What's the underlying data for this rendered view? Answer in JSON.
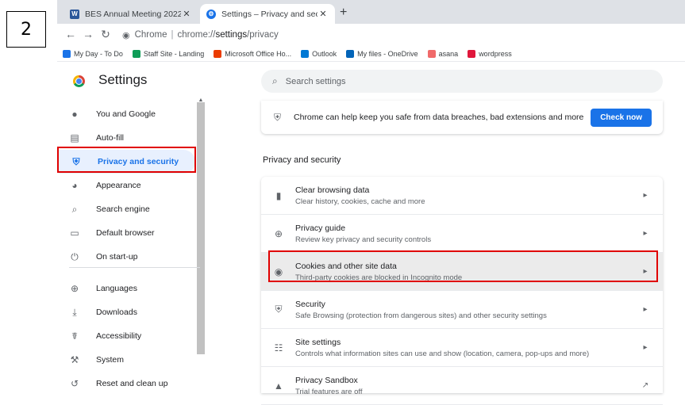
{
  "step_number": "2",
  "tabs": [
    {
      "label": "BES Annual Meeting 2022",
      "icon": "word-icon"
    },
    {
      "label": "Settings – Privacy and security",
      "icon": "settings-gear-icon"
    }
  ],
  "address": {
    "host": "Chrome",
    "path_prefix": "chrome://",
    "path_main": "settings",
    "path_suffix": "/privacy"
  },
  "bookmarks": [
    {
      "label": "My Day - To Do",
      "color": "#1a73e8"
    },
    {
      "label": "Staff Site - Landing",
      "color": "#0f9d58"
    },
    {
      "label": "Microsoft Office Ho...",
      "color": "#eb3c00"
    },
    {
      "label": "Outlook",
      "color": "#0078d4"
    },
    {
      "label": "My files - OneDrive",
      "color": "#0364b8"
    },
    {
      "label": "asana",
      "color": "#f06a6a"
    },
    {
      "label": "wordpress",
      "color": "#e0173b"
    }
  ],
  "settings_title": "Settings",
  "search_placeholder": "Search settings",
  "sidebar": [
    {
      "label": "You and Google",
      "icon": "person-icon",
      "glyph": "●"
    },
    {
      "label": "Auto-fill",
      "icon": "clipboard-icon",
      "glyph": "▤"
    },
    {
      "label": "Privacy and security",
      "icon": "shield-icon",
      "glyph": "⛨"
    },
    {
      "label": "Appearance",
      "icon": "palette-icon",
      "glyph": "◕"
    },
    {
      "label": "Search engine",
      "icon": "search-icon",
      "glyph": "⌕"
    },
    {
      "label": "Default browser",
      "icon": "browser-window-icon",
      "glyph": "▭"
    },
    {
      "label": "On start-up",
      "icon": "power-icon",
      "glyph": "⏻"
    },
    {
      "label": "Languages",
      "icon": "globe-icon",
      "glyph": "⊕"
    },
    {
      "label": "Downloads",
      "icon": "download-icon",
      "glyph": "⤓"
    },
    {
      "label": "Accessibility",
      "icon": "accessibility-icon",
      "glyph": "☤"
    },
    {
      "label": "System",
      "icon": "wrench-icon",
      "glyph": "⚒"
    },
    {
      "label": "Reset and clean up",
      "icon": "restore-icon",
      "glyph": "↺"
    }
  ],
  "safety_check": {
    "message": "Chrome can help keep you safe from data breaches, bad extensions and more",
    "button": "Check now"
  },
  "section_title": "Privacy and security",
  "privacy_rows": [
    {
      "title": "Clear browsing data",
      "subtitle": "Clear history, cookies, cache and more",
      "icon": "trash-icon",
      "glyph": "▮",
      "action": "▸"
    },
    {
      "title": "Privacy guide",
      "subtitle": "Review key privacy and security controls",
      "icon": "compass-icon",
      "glyph": "⊕",
      "action": "▸"
    },
    {
      "title": "Cookies and other site data",
      "subtitle": "Third-party cookies are blocked in Incognito mode",
      "icon": "cookie-icon",
      "glyph": "◉",
      "action": "▸"
    },
    {
      "title": "Security",
      "subtitle": "Safe Browsing (protection from dangerous sites) and other security settings",
      "icon": "shield-icon",
      "glyph": "⛨",
      "action": "▸"
    },
    {
      "title": "Site settings",
      "subtitle": "Controls what information sites can use and show (location, camera, pop-ups and more)",
      "icon": "sliders-icon",
      "glyph": "☷",
      "action": "▸"
    },
    {
      "title": "Privacy Sandbox",
      "subtitle": "Trial features are off",
      "icon": "flask-icon",
      "glyph": "▲",
      "action": "↗"
    }
  ]
}
